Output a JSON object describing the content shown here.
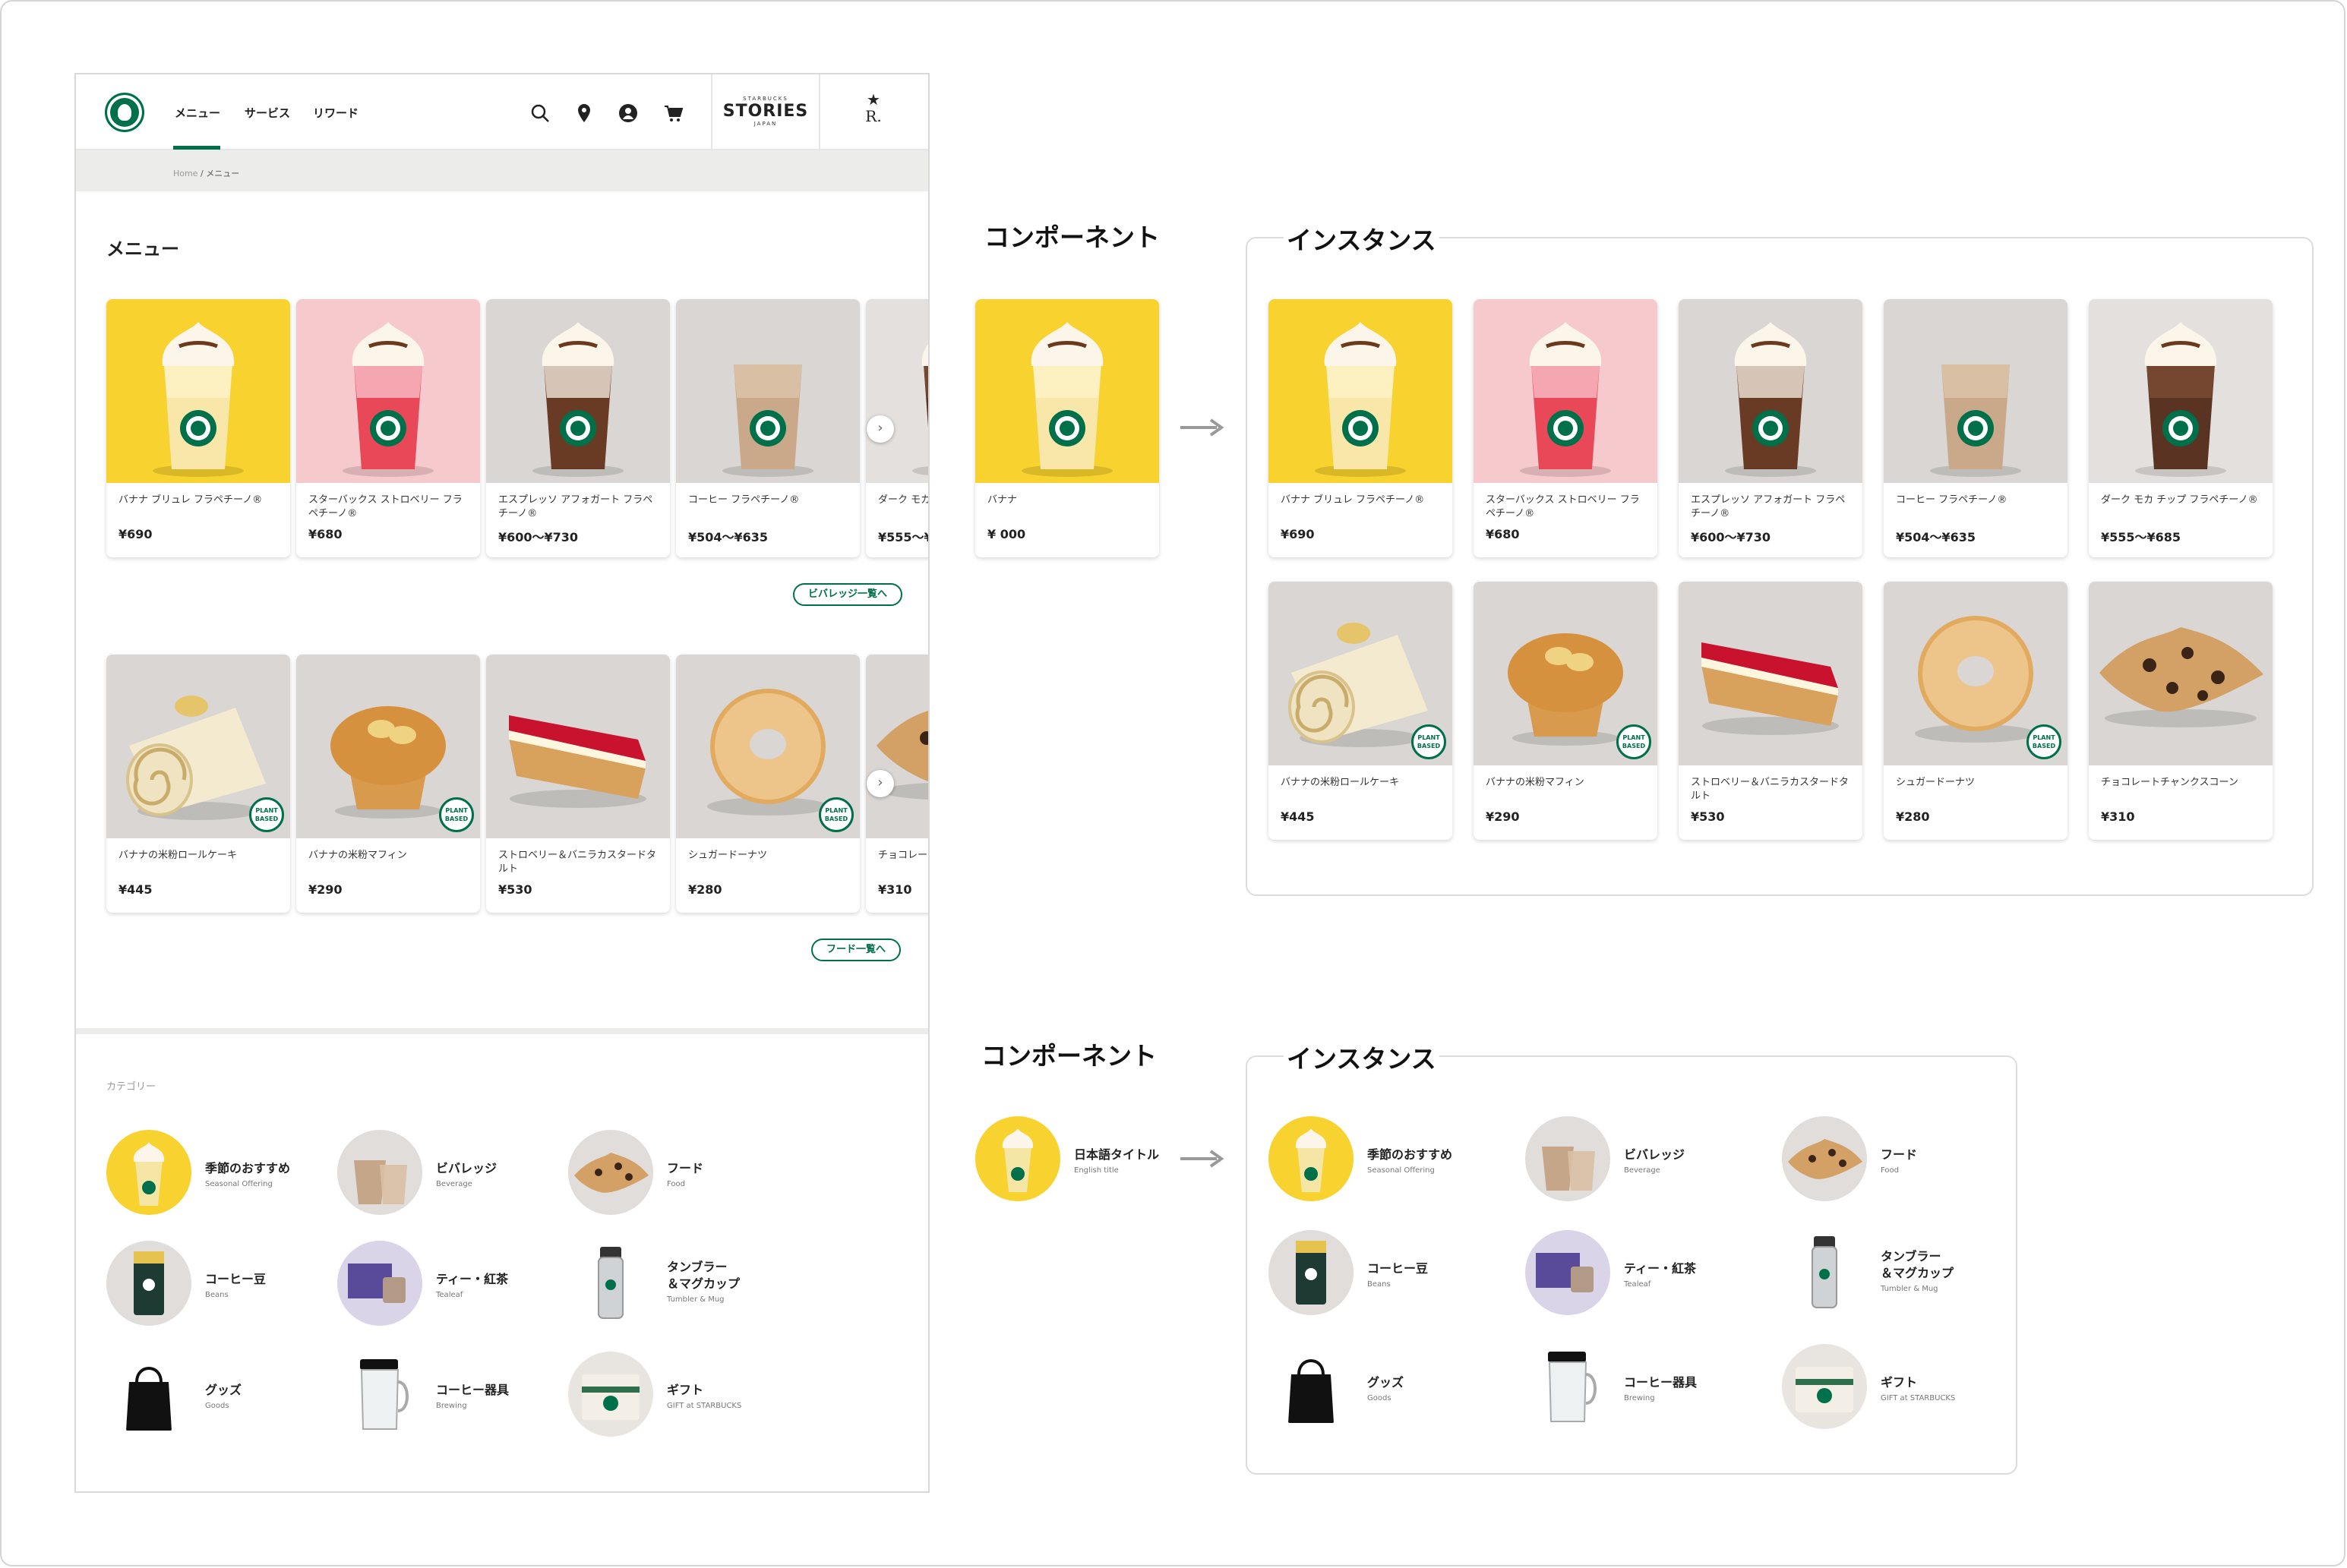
{
  "site": {
    "nav": [
      "メニュー",
      "サービス",
      "リワード"
    ],
    "stories_small": "STARBUCKS",
    "stories_big": "STORIES",
    "stories_sub": "JAPAN",
    "reserve": "R.",
    "breadcrumb_home": "Home",
    "breadcrumb_sep": "/",
    "breadcrumb_current": "メニュー",
    "menu_title": "メニュー",
    "beverages": [
      {
        "name": "バナナ ブリュレ フラペチーノ®",
        "price": "¥690"
      },
      {
        "name": "スターバックス ストロベリー フラペチーノ®",
        "price": "¥680"
      },
      {
        "name": "エスプレッソ アフォガート フラペチーノ®",
        "price": "¥600〜¥730"
      },
      {
        "name": "コーヒー フラペチーノ®",
        "price": "¥504〜¥635"
      },
      {
        "name": "ダーク モカ チップ フラペチーノ®",
        "price": "¥555〜¥685"
      }
    ],
    "beverage_more": "ビバレッジ一覧へ",
    "foods": [
      {
        "name": "バナナの米粉ロールケーキ",
        "price": "¥445"
      },
      {
        "name": "バナナの米粉マフィン",
        "price": "¥290"
      },
      {
        "name": "ストロベリー＆バニラカスタードタルト",
        "price": "¥530"
      },
      {
        "name": "シュガードーナツ",
        "price": "¥280"
      },
      {
        "name": "チョコレートチャンクスコーン",
        "price": "¥310"
      }
    ],
    "food_more": "フード一覧へ",
    "category_label": "カテゴリー",
    "categories": [
      {
        "jp": "季節のおすすめ",
        "en": "Seasonal Offering"
      },
      {
        "jp": "ビバレッジ",
        "en": "Beverage"
      },
      {
        "jp": "フード",
        "en": "Food"
      },
      {
        "jp": "コーヒー豆",
        "en": "Beans"
      },
      {
        "jp": "ティー・紅茶",
        "en": "Tealeaf"
      },
      {
        "jp": "タンブラー\n＆マグカップ",
        "en": "Tumbler & Mug"
      },
      {
        "jp": "グッズ",
        "en": "Goods"
      },
      {
        "jp": "コーヒー器具",
        "en": "Brewing"
      },
      {
        "jp": "ギフト",
        "en": "GIFT at STARBUCKS"
      }
    ],
    "plant_badge_top": "PLANT",
    "plant_badge_bottom": "BASED"
  },
  "component_heading": "コンポーネント",
  "instance_heading": "インスタンス",
  "component_card": {
    "name": "バナナ",
    "price": "¥ 000"
  },
  "component_category": {
    "jp": "日本語タイトル",
    "en": "English title"
  },
  "colors": {
    "brand_green": "#00704a",
    "border": "#dcdcdc",
    "breadcrumb_bg": "#ececea"
  },
  "icons": [
    "search-icon",
    "location-icon",
    "account-icon",
    "cart-icon",
    "chevron-right-icon",
    "arrow-right-icon"
  ]
}
